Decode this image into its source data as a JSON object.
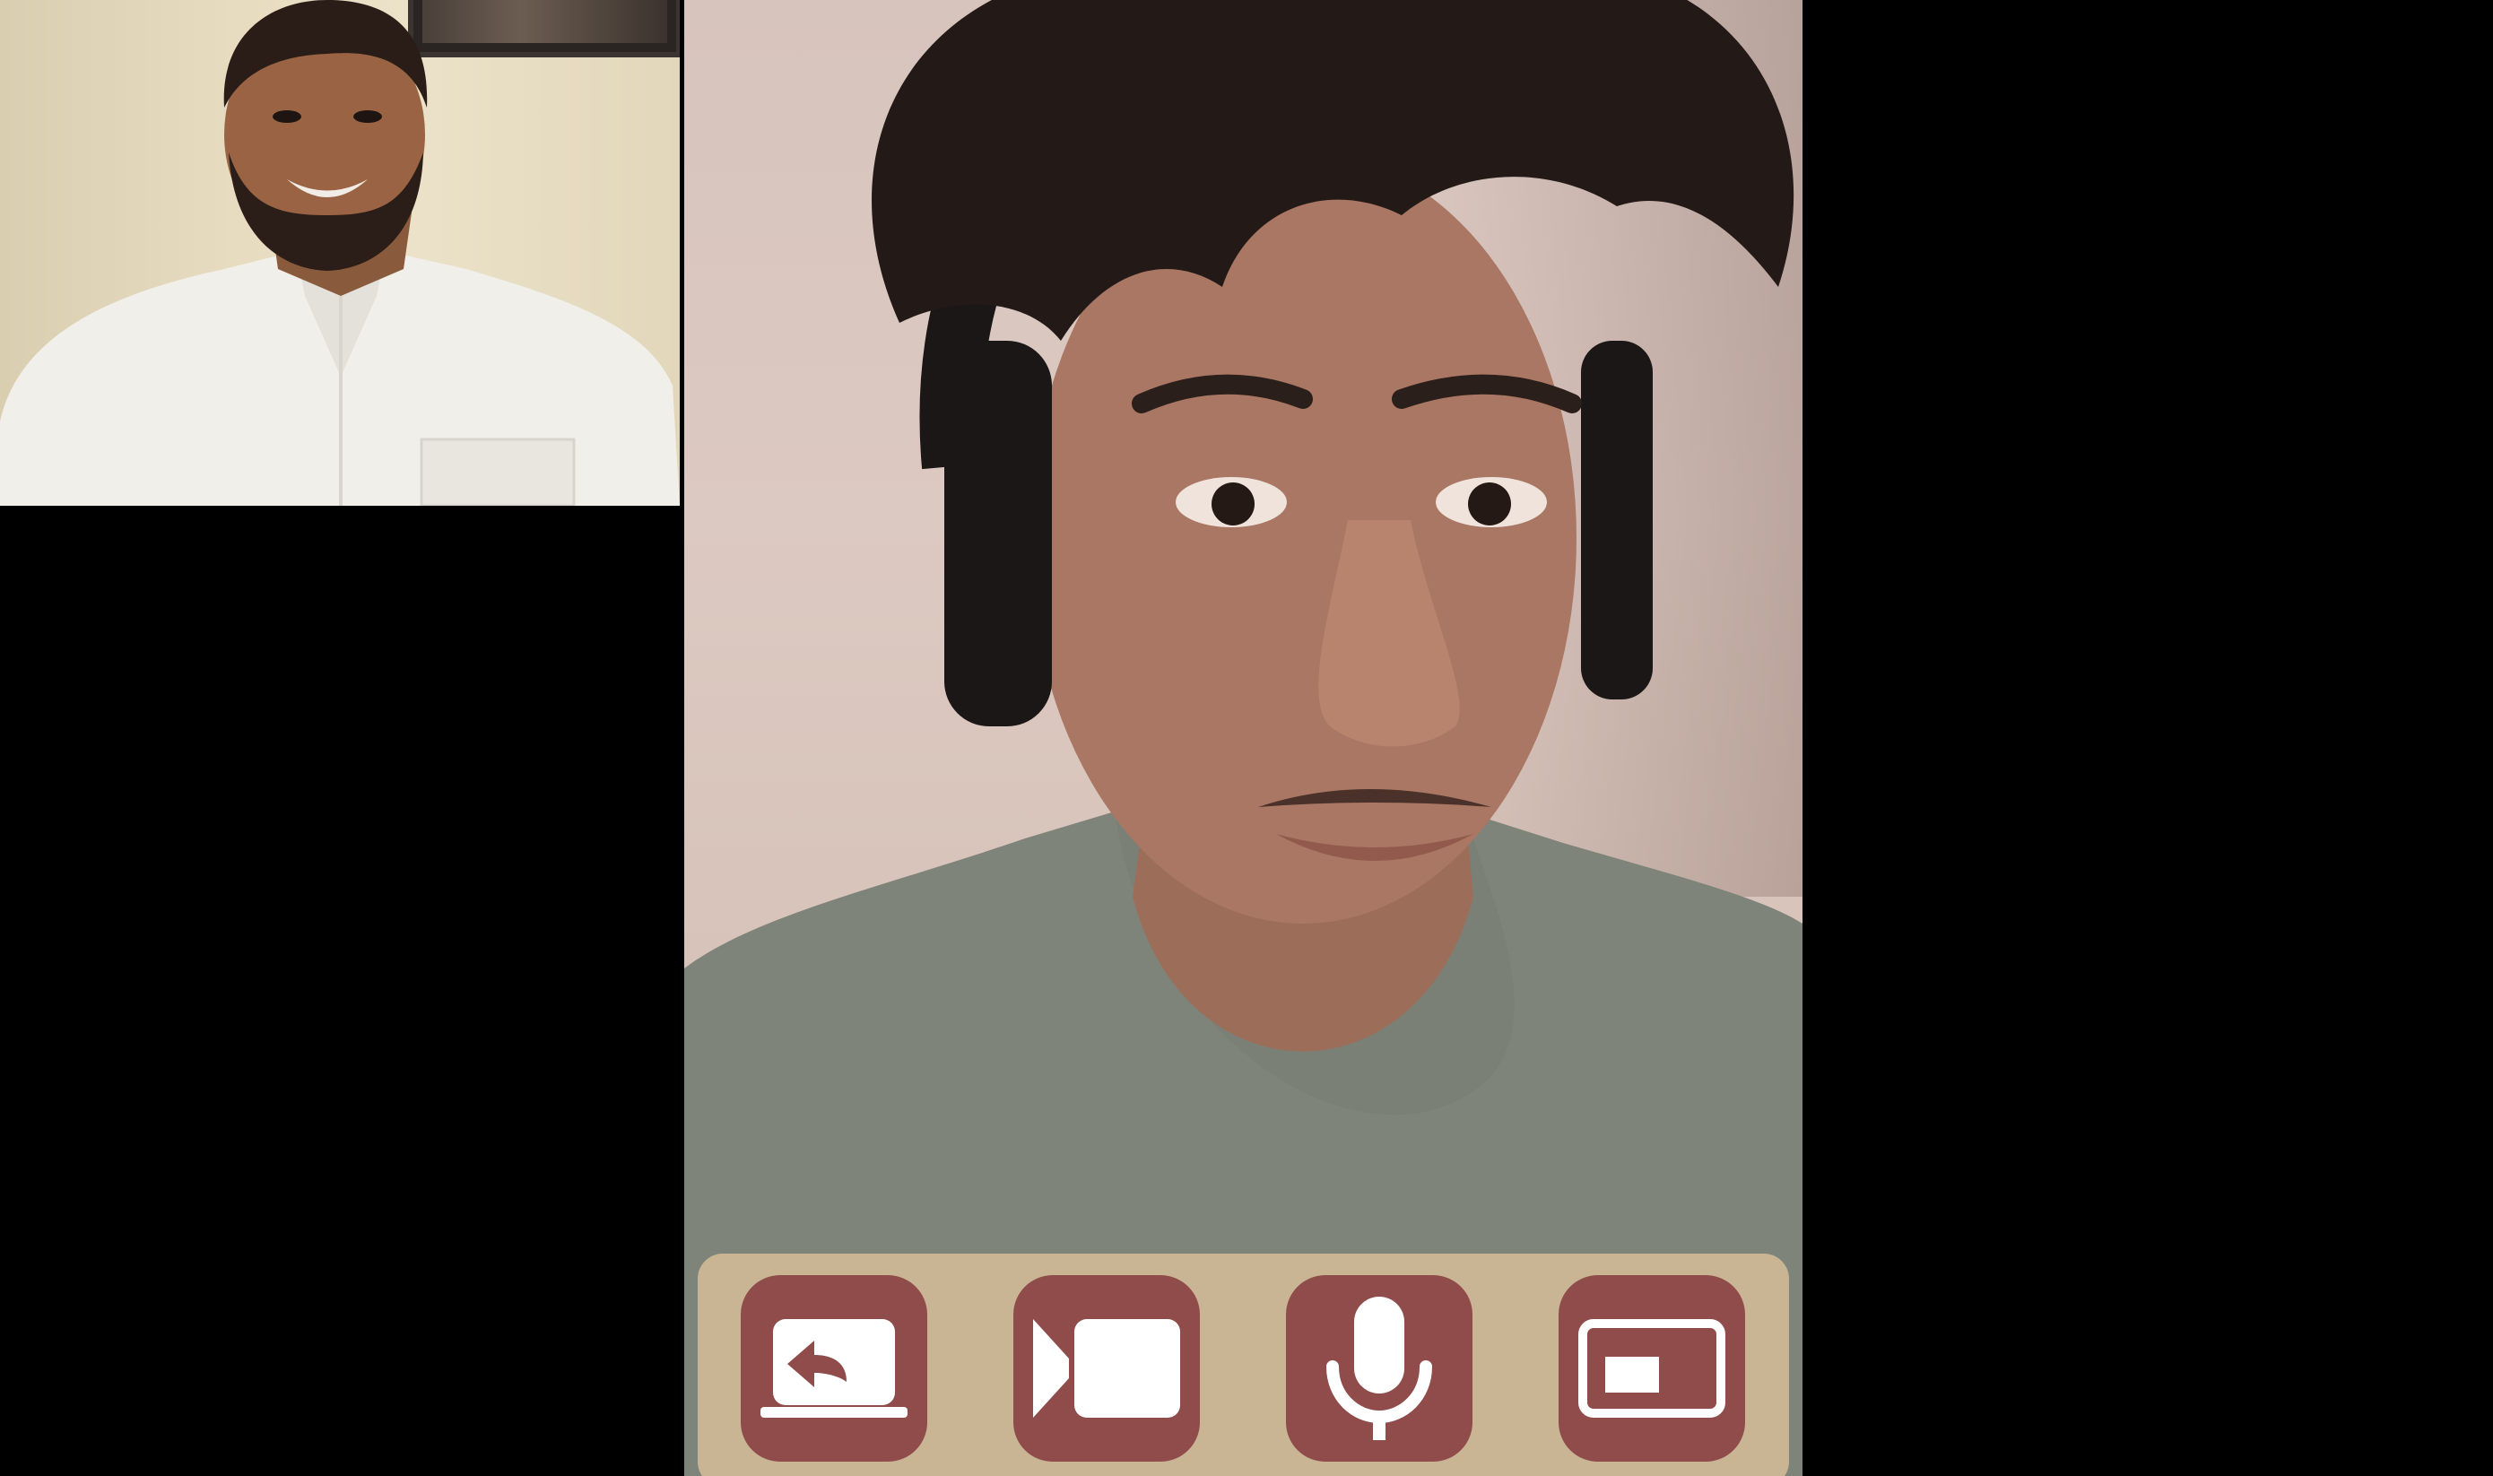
{
  "window": {
    "background_color": "#000000"
  },
  "remote_participant": {
    "video_feed": "remote-participant-video"
  },
  "self_view": {
    "video_feed": "self-participant-video"
  },
  "controls": {
    "bar_color": "#c9b594",
    "button_color": "#8f4c4b",
    "icon_color": "#ffffff",
    "buttons": [
      {
        "icon": "share-screen-icon"
      },
      {
        "icon": "video-camera-icon"
      },
      {
        "icon": "microphone-icon"
      },
      {
        "icon": "picture-in-picture-icon"
      }
    ]
  }
}
